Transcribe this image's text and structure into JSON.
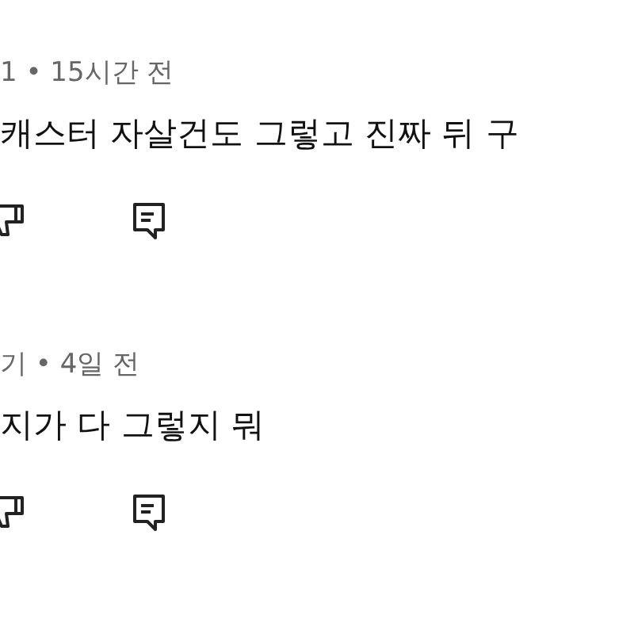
{
  "comments": [
    {
      "meta": "1 • 15시간 전",
      "text": "캐스터 자살건도 그렇고 진짜 뒤 구"
    },
    {
      "meta": "기 • 4일 전",
      "text": "지가 다 그렇지 뭐"
    }
  ]
}
